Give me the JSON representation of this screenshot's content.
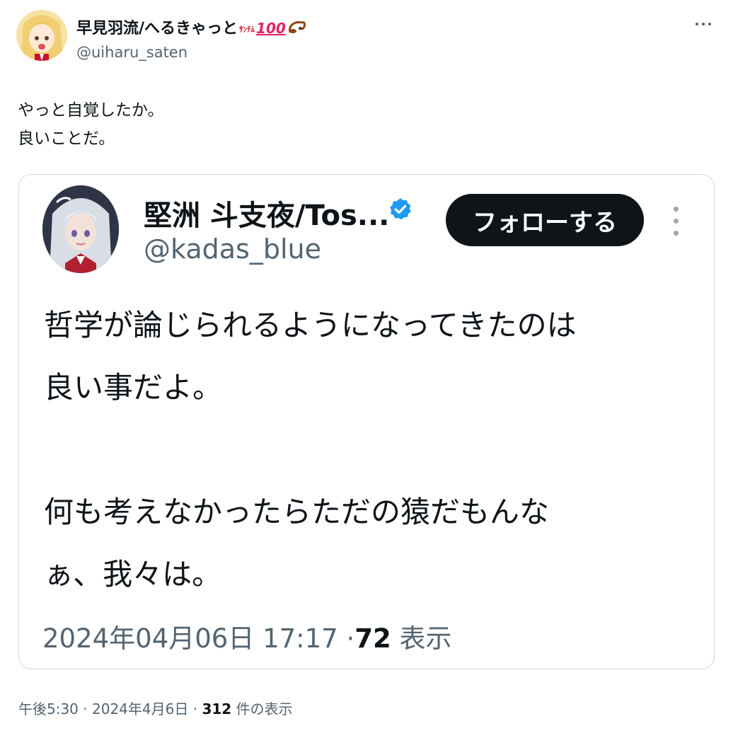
{
  "tweet": {
    "display_name": "早見羽流/へるきゃっと",
    "name_badge_text": "ｻﾝﾁﾑ",
    "name_badge_100": "100",
    "handle": "@uiharu_saten",
    "text": "やっと自覚したか。\n良いことだ。",
    "footer_time": "午後5:30",
    "footer_date": "2024年4月6日",
    "footer_views_count": "312",
    "footer_views_label": "件の表示",
    "separator": "·"
  },
  "quoted": {
    "display_name": "堅洲 斗支夜/Tos...",
    "handle": "@kadas_blue",
    "follow_label": "フォローする",
    "text": "哲学が論じられるようになってきたのは\n良い事だよ。\n\n何も考えなかったらただの猿だもんな\nぁ、我々は。",
    "date_time": "2024年04月06日 17:17",
    "views_count": "72",
    "views_label": "表示",
    "separator": "·"
  },
  "icons": {
    "more": "more-horizontal-icon",
    "quote_more": "more-vertical-icon",
    "verified": "verified-badge-icon",
    "scorpion": "scorpion-emoji-icon"
  },
  "colors": {
    "text": "#0f1419",
    "secondary": "#536471",
    "border": "#cfd9de",
    "verified": "#1d9bf0",
    "button_bg": "#0f1419"
  }
}
